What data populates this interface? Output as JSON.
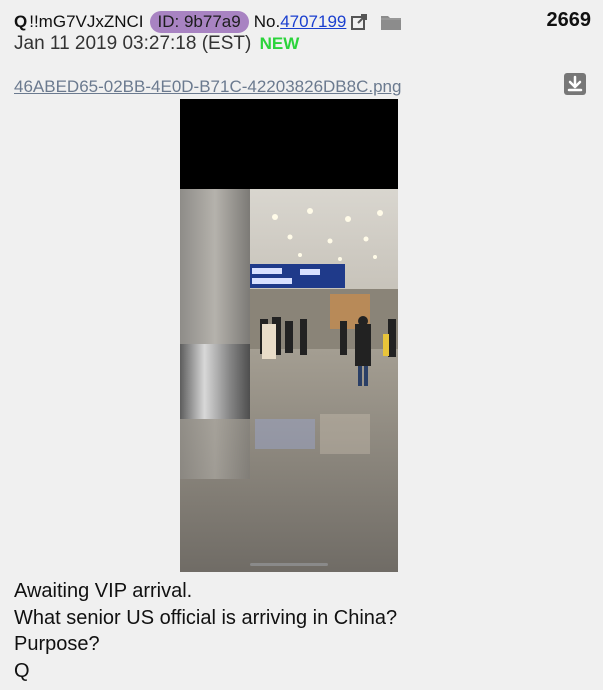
{
  "post": {
    "author": "Q",
    "tripcode": "!!mG7VJxZNCI",
    "id_label": "ID: 9b77a9",
    "no_prefix": "No.",
    "number": "4707199",
    "count": "2669",
    "datetime": "Jan 11 2019 03:27:18 (EST)",
    "new_label": "NEW",
    "filename": "46ABED65-02BB-4E0D-B71C-42203826DB8C.png",
    "body_lines": [
      "Awaiting VIP arrival.",
      "What senior US official is arriving in China?",
      "Purpose?",
      "Q"
    ]
  },
  "icons": {
    "external": "external-link-icon",
    "folder": "folder-icon",
    "download": "download-icon"
  },
  "colors": {
    "id_badge": "#a883c2",
    "new": "#2bd43b",
    "link": "#1a3fcf",
    "filename": "#6b7a8f",
    "background": "#f0f0f0"
  }
}
